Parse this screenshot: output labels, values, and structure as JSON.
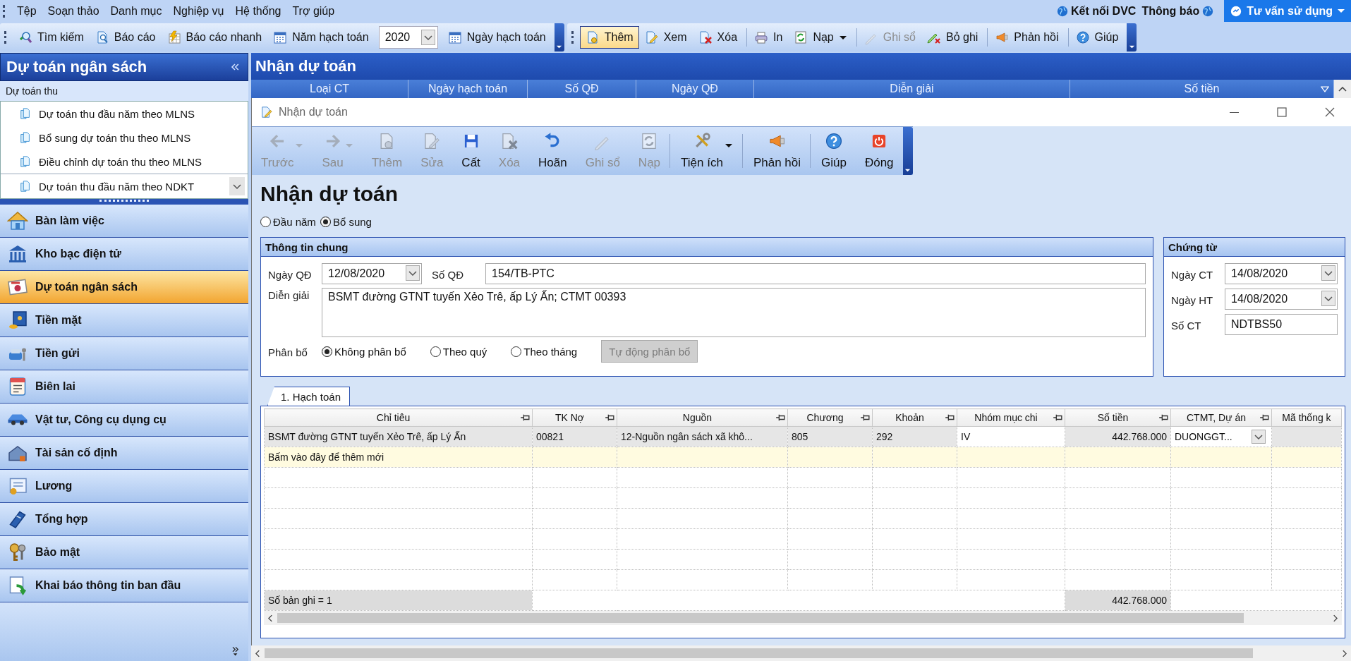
{
  "menu": [
    "Tệp",
    "Soạn thảo",
    "Danh mục",
    "Nghiệp vụ",
    "Hệ thống",
    "Trợ giúp"
  ],
  "top_links": [
    "Kết nối DVC",
    "Thông báo"
  ],
  "consult_button": "Tư vấn sử dụng",
  "toolbar_left": [
    {
      "kind": "button",
      "label": "Tìm kiếm"
    },
    {
      "kind": "button",
      "label": "Báo cáo"
    },
    {
      "kind": "button",
      "label": "Báo cáo nhanh"
    },
    {
      "kind": "button",
      "label": "Năm hạch toán"
    },
    {
      "kind": "combo",
      "value": "2020"
    },
    {
      "kind": "button",
      "label": "Ngày hạch toán"
    }
  ],
  "toolbar_right": [
    {
      "label": "Thêm",
      "selected": true,
      "disabled": false,
      "dropdown": false,
      "separator_before": false
    },
    {
      "label": "Xem",
      "selected": false,
      "disabled": false,
      "dropdown": false,
      "separator_before": false
    },
    {
      "label": "Xóa",
      "selected": false,
      "disabled": false,
      "dropdown": false,
      "separator_before": false
    },
    {
      "label": "In",
      "selected": false,
      "disabled": false,
      "dropdown": false,
      "separator_before": true
    },
    {
      "label": "Nạp",
      "selected": false,
      "disabled": false,
      "dropdown": true,
      "separator_before": false
    },
    {
      "label": "Ghi sổ",
      "selected": false,
      "disabled": true,
      "dropdown": false,
      "separator_before": true
    },
    {
      "label": "Bỏ ghi",
      "selected": false,
      "disabled": false,
      "dropdown": false,
      "separator_before": false
    },
    {
      "label": "Phản hồi",
      "selected": false,
      "disabled": false,
      "dropdown": false,
      "separator_before": true
    },
    {
      "label": "Giúp",
      "selected": false,
      "disabled": false,
      "dropdown": false,
      "separator_before": true
    }
  ],
  "sidebar": {
    "title": "Dự toán ngân sách",
    "section": "Dự toán thu",
    "items": [
      "Dự toán thu đầu năm theo MLNS",
      "Bổ sung dự toán thu theo MLNS",
      "Điều chỉnh dự toán thu theo MLNS"
    ],
    "more_item": "Dự toán thu đầu năm theo NDKT",
    "nav": [
      {
        "label": "Bàn làm việc",
        "selected": false
      },
      {
        "label": "Kho bạc điện tử",
        "selected": false
      },
      {
        "label": "Dự toán ngân sách",
        "selected": true
      },
      {
        "label": "Tiền mặt",
        "selected": false
      },
      {
        "label": "Tiền gửi",
        "selected": false
      },
      {
        "label": "Biên lai",
        "selected": false
      },
      {
        "label": "Vật tư, Công cụ dụng cụ",
        "selected": false
      },
      {
        "label": "Tài sản cố định",
        "selected": false
      },
      {
        "label": "Lương",
        "selected": false
      },
      {
        "label": "Tổng hợp",
        "selected": false
      },
      {
        "label": "Bảo mật",
        "selected": false
      },
      {
        "label": "Khai báo thông tin ban đầu",
        "selected": false
      }
    ]
  },
  "main": {
    "title": "Nhận dự toán",
    "columns": [
      "Loại CT",
      "Ngày hạch toán",
      "Số QĐ",
      "Ngày QĐ",
      "Diễn giải",
      "Số tiền"
    ]
  },
  "dialog": {
    "title": "Nhận dự toán",
    "toolbar": [
      {
        "label": "Trước",
        "disabled": true,
        "dropdown": true,
        "separator_before": false
      },
      {
        "label": "Sau",
        "disabled": true,
        "dropdown": true,
        "separator_before": false
      },
      {
        "label": "Thêm",
        "disabled": true,
        "dropdown": false,
        "separator_before": false
      },
      {
        "label": "Sửa",
        "disabled": true,
        "dropdown": false,
        "separator_before": false
      },
      {
        "label": "Cất",
        "disabled": false,
        "dropdown": false,
        "separator_before": false
      },
      {
        "label": "Xóa",
        "disabled": true,
        "dropdown": false,
        "separator_before": false
      },
      {
        "label": "Hoãn",
        "disabled": false,
        "dropdown": false,
        "separator_before": false
      },
      {
        "label": "Ghi sổ",
        "disabled": true,
        "dropdown": false,
        "separator_before": false
      },
      {
        "label": "Nạp",
        "disabled": true,
        "dropdown": false,
        "separator_before": false
      },
      {
        "label": "Tiện ích",
        "disabled": false,
        "dropdown": true,
        "separator_before": true
      },
      {
        "label": "Phản hồi",
        "disabled": false,
        "dropdown": false,
        "separator_before": true
      },
      {
        "label": "Giúp",
        "disabled": false,
        "dropdown": false,
        "separator_before": true
      },
      {
        "label": "Đóng",
        "disabled": false,
        "dropdown": false,
        "separator_before": false
      }
    ],
    "heading": "Nhận dự toán",
    "type_options": [
      {
        "label": "Đầu năm",
        "selected": false
      },
      {
        "label": "Bổ sung",
        "selected": true
      }
    ],
    "general": {
      "title": "Thông tin chung",
      "decision_date": {
        "label": "Ngày QĐ",
        "value": "12/08/2020"
      },
      "decision_no": {
        "label": "Số QĐ",
        "value": "154/TB-PTC"
      },
      "description": {
        "label": "Diễn giải",
        "value": "BSMT đường GTNT tuyến Xẻo Trê, ấp Lý Ấn; CTMT 00393"
      },
      "allocation": {
        "label": "Phân bổ",
        "options": [
          {
            "label": "Không phân bổ",
            "selected": true
          },
          {
            "label": "Theo quý",
            "selected": false
          },
          {
            "label": "Theo tháng",
            "selected": false
          }
        ],
        "button": {
          "label": "Tự động phân bổ",
          "disabled": true
        }
      }
    },
    "voucher": {
      "title": "Chứng từ",
      "fields": [
        {
          "kind": "date",
          "label": "Ngày CT",
          "value": "14/08/2020"
        },
        {
          "kind": "date",
          "label": "Ngày HT",
          "value": "14/08/2020"
        },
        {
          "kind": "text",
          "label": "Số CT",
          "value": "NDTBS50"
        }
      ]
    },
    "tabs": [
      {
        "label": "1. Hạch toán",
        "selected": true
      }
    ],
    "grid": {
      "columns": [
        {
          "label": "Chỉ tiêu",
          "kind": "text"
        },
        {
          "label": "TK Nợ",
          "kind": "text"
        },
        {
          "label": "Nguồn",
          "kind": "text"
        },
        {
          "label": "Chương",
          "kind": "text"
        },
        {
          "label": "Khoản",
          "kind": "text"
        },
        {
          "label": "Nhóm mục chi",
          "kind": "input"
        },
        {
          "label": "Số tiền",
          "kind": "money"
        },
        {
          "label": "CTMT, Dự án",
          "kind": "combo"
        },
        {
          "label": "Mã thống k",
          "kind": "text"
        }
      ],
      "rows": [
        [
          "BSMT đường GTNT tuyến Xẻo Trê, ấp Lý Ấn",
          "00821",
          "12-Nguồn ngân sách xã khô...",
          "805",
          "292",
          "IV",
          "442.768.000",
          "DUONGGT...",
          ""
        ]
      ],
      "new_row_hint": "Bấm vào đây để thêm mới",
      "footer": {
        "count": "Số bản ghi = 1",
        "total": "442.768.000"
      }
    }
  }
}
